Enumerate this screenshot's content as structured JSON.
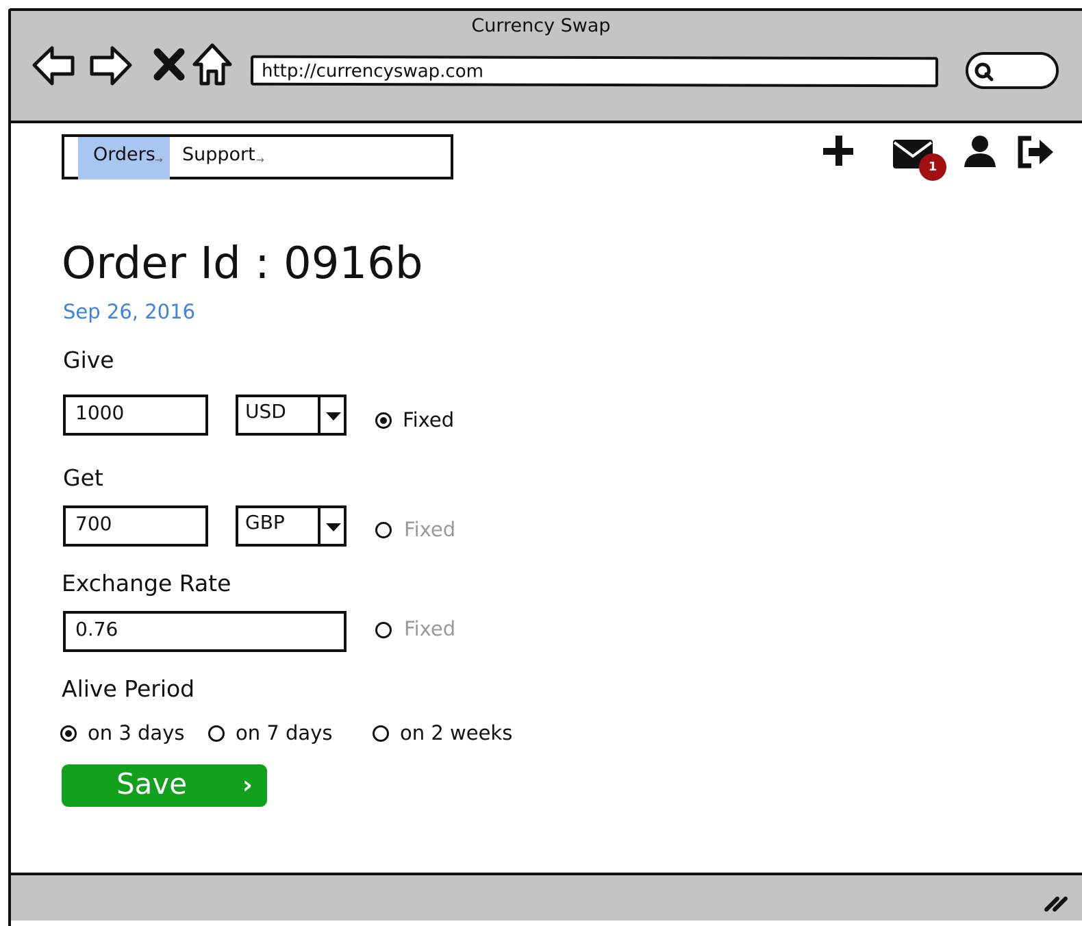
{
  "window": {
    "title": "Currency Swap"
  },
  "browser": {
    "url": "http://currencyswap.com",
    "nav_icons": [
      "back-arrow-icon",
      "forward-arrow-icon",
      "close-icon",
      "home-icon"
    ],
    "search_icon": "search-icon"
  },
  "tabs": [
    {
      "label": "Orders",
      "active": true
    },
    {
      "label": "Support",
      "active": false
    }
  ],
  "header_icons": {
    "add": "plus-icon",
    "messages": "envelope-icon",
    "messages_badge": "1",
    "profile": "user-icon",
    "logout": "sign-out-icon"
  },
  "order": {
    "title": "Order Id : 0916b",
    "date": "Sep 26, 2016"
  },
  "give": {
    "label": "Give",
    "amount": "1000",
    "currency": "USD",
    "fixed_label": "Fixed",
    "fixed_checked": true
  },
  "get": {
    "label": "Get",
    "amount": "700",
    "currency": "GBP",
    "fixed_label": "Fixed",
    "fixed_checked": false
  },
  "rate": {
    "label": "Exchange Rate",
    "value": "0.76",
    "fixed_label": "Fixed",
    "fixed_checked": false
  },
  "alive_period": {
    "label": "Alive Period",
    "options": [
      {
        "label": "on 3 days",
        "checked": true
      },
      {
        "label": "on 7 days",
        "checked": false
      },
      {
        "label": "on 2 weeks",
        "checked": false
      }
    ]
  },
  "save": {
    "label": "Save"
  },
  "colors": {
    "chrome": "#c4c4c4",
    "active_tab": "#a7c6f2",
    "date": "#3d83e0",
    "badge": "#a30f0f",
    "save_button": "#12a11c"
  }
}
